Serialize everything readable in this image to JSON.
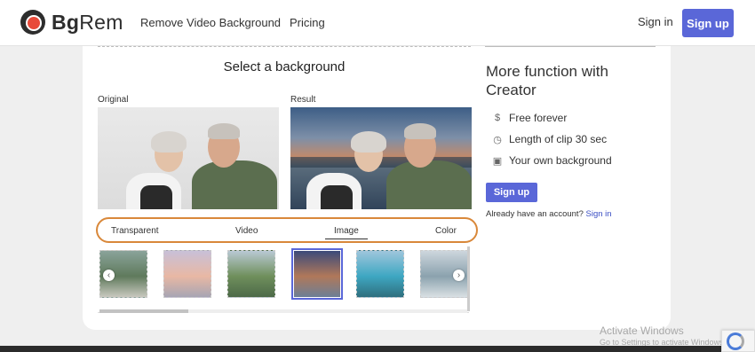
{
  "header": {
    "brand_bold": "Bg",
    "brand_rest": "Rem",
    "nav": [
      "Remove Video Background",
      "Pricing"
    ],
    "signin": "Sign in",
    "signup": "Sign up"
  },
  "editor": {
    "title": "Select a background",
    "original_label": "Original",
    "result_label": "Result",
    "tabs": [
      "Transparent",
      "Video",
      "Image",
      "Color"
    ],
    "active_tab": "Image",
    "thumbnails": [
      {
        "name": "beach-palms",
        "colors": [
          "#8aa39a",
          "#5f7a5c",
          "#c8c8be"
        ]
      },
      {
        "name": "sunset-sky",
        "colors": [
          "#c8c0d8",
          "#e8b8a4",
          "#a7a5b3"
        ]
      },
      {
        "name": "river-mountain",
        "colors": [
          "#b9c9d4",
          "#6f8f5c",
          "#4d6a48"
        ]
      },
      {
        "name": "lake-mountain-sunset",
        "colors": [
          "#3b4a7a",
          "#b0785a",
          "#6c7f96"
        ]
      },
      {
        "name": "turquoise-lake",
        "colors": [
          "#9fc6dc",
          "#3ea7c2",
          "#2f6f7e"
        ]
      },
      {
        "name": "coast-mist",
        "colors": [
          "#cdd6dd",
          "#8ba2ae",
          "#d9e0e3"
        ]
      }
    ]
  },
  "sidebar": {
    "title": "More function with Creator",
    "features": [
      {
        "icon": "dollar-icon",
        "text": "Free forever"
      },
      {
        "icon": "clock-icon",
        "text": "Length of clip 30 sec"
      },
      {
        "icon": "image-icon",
        "text": "Your own background"
      }
    ],
    "signup": "Sign up",
    "already_text": "Already have an account?",
    "signin_link": "Sign in"
  },
  "watermark": {
    "title": "Activate Windows",
    "subtitle": "Go to Settings to activate Windows."
  },
  "colors": {
    "accent": "#5a67d8",
    "highlight_oval": "#d9883a"
  }
}
